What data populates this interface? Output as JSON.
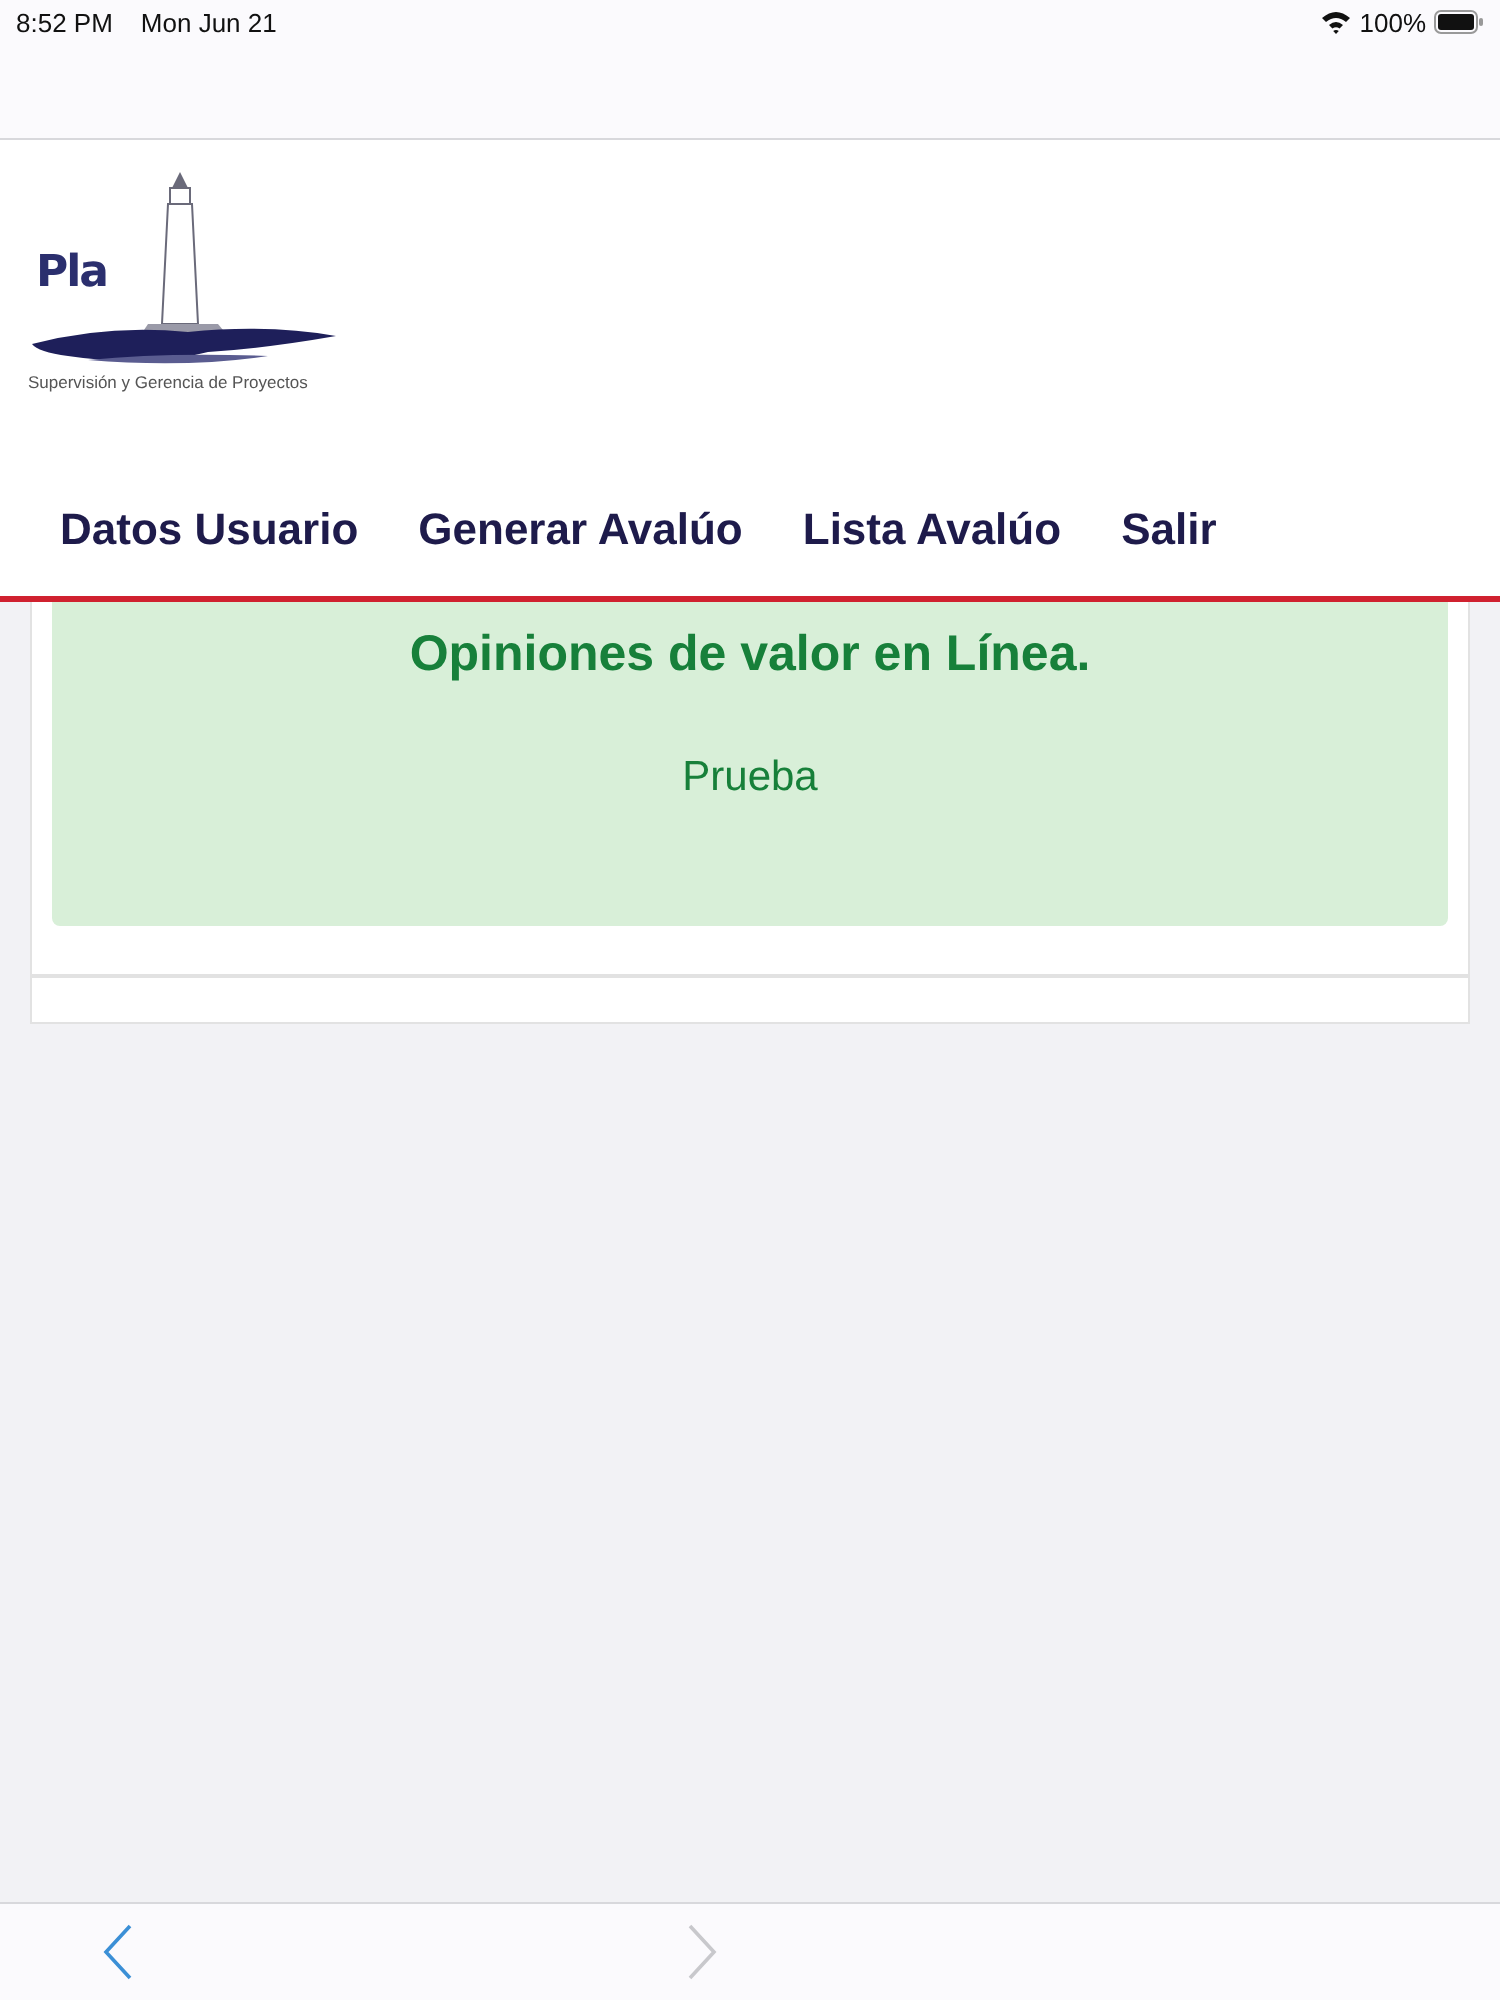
{
  "status_bar": {
    "time": "8:52 PM",
    "date": "Mon Jun 21",
    "battery": "100%"
  },
  "logo": {
    "wordmark": "Pla",
    "tagline": "Supervisión y Gerencia de Proyectos"
  },
  "nav": [
    {
      "label": "Datos Usuario"
    },
    {
      "label": "Generar Avalúo"
    },
    {
      "label": "Lista Avalúo"
    },
    {
      "label": "Salir"
    }
  ],
  "alert": {
    "heading": "Opiniones de valor en Línea.",
    "body": "Prueba"
  },
  "browser_toolbar": {
    "back": {
      "disabled": false
    },
    "forward": {
      "disabled": true
    }
  }
}
